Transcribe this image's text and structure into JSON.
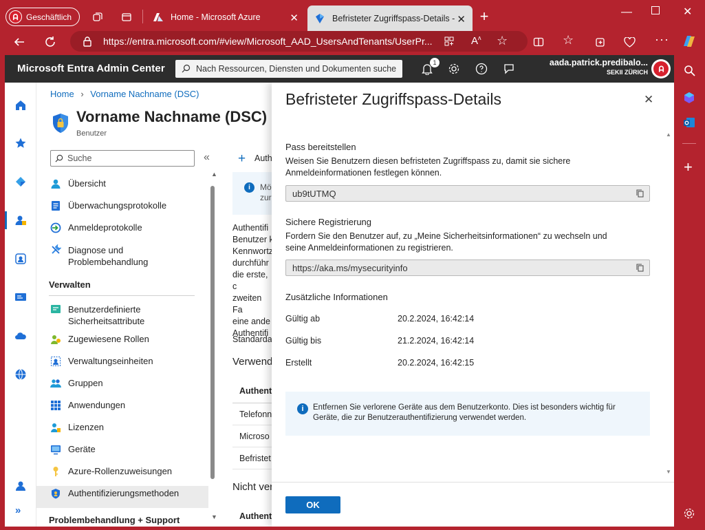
{
  "browser": {
    "profile_label": "Geschäftlich",
    "tabs": [
      {
        "title": "Home - Microsoft Azure"
      },
      {
        "title": "Befristeter Zugriffspass-Details -"
      }
    ],
    "url": "https://entra.microsoft.com/#view/Microsoft_AAD_UsersAndTenants/UserPr..."
  },
  "header": {
    "brand": "Microsoft Entra Admin Center",
    "search_placeholder": "Nach Ressourcen, Diensten und Dokumenten suche",
    "notification_count": "1",
    "user_name": "aada.patrick.predibalo...",
    "tenant": "SEKII ZÜRICH"
  },
  "breadcrumb": {
    "home": "Home",
    "current": "Vorname Nachname (DSC)"
  },
  "page": {
    "title": "Vorname Nachname (DSC)",
    "subtitle": "Benutzer"
  },
  "left": {
    "search_placeholder": "Suche",
    "collapse": "«",
    "items_top": [
      {
        "label": "Übersicht",
        "icon": "user-icon"
      },
      {
        "label": "Überwachungsprotokolle",
        "icon": "log-icon"
      },
      {
        "label": "Anmeldeprotokolle",
        "icon": "signin-icon"
      },
      {
        "label": "Diagnose und Problembehandlung",
        "icon": "wrench-icon"
      }
    ],
    "section_manage": "Verwalten",
    "items_manage": [
      {
        "label": "Benutzerdefinierte Sicherheitsattribute",
        "icon": "attribute-icon"
      },
      {
        "label": "Zugewiesene Rollen",
        "icon": "roles-icon"
      },
      {
        "label": "Verwaltungseinheiten",
        "icon": "admin-units-icon"
      },
      {
        "label": "Gruppen",
        "icon": "groups-icon"
      },
      {
        "label": "Anwendungen",
        "icon": "apps-icon"
      },
      {
        "label": "Lizenzen",
        "icon": "license-icon"
      },
      {
        "label": "Geräte",
        "icon": "device-icon"
      },
      {
        "label": "Azure-Rollenzuweisungen",
        "icon": "key-icon"
      },
      {
        "label": "Authentifizierungsmethoden",
        "icon": "shield-icon"
      }
    ],
    "section_support": "Problembehandlung + Support"
  },
  "middle": {
    "add_label": "Auth",
    "info": [
      "Mö",
      "zur"
    ],
    "paragraph": [
      "Authentifi",
      "Benutzer k",
      "Kennwortz",
      "durchführ",
      "die erste, c",
      "zweiten Fa",
      "eine ande",
      "Authentifi"
    ],
    "default_label": "Standarda",
    "used_heading": "Verwend",
    "table_header": "Authent",
    "rows": [
      "Telefonn",
      "Microso",
      "Befristet"
    ],
    "not_used_heading": "Nicht ver",
    "table_header2": "Authent"
  },
  "panel": {
    "title": "Befristeter Zugriffspass-Details",
    "pass_heading": "Pass bereitstellen",
    "pass_desc": "Weisen Sie Benutzern diesen befristeten Zugriffspass zu, damit sie sichere Anmeldeinformationen festlegen können.",
    "pass_value": "ub9tUTMQ",
    "reg_heading": "Sichere Registrierung",
    "reg_desc": "Fordern Sie den Benutzer auf, zu „Meine Sicherheitsinformationen“ zu wechseln und seine Anmeldeinformationen zu registrieren.",
    "reg_value": "https://aka.ms/mysecurityinfo",
    "extra_heading": "Zusätzliche Informationen",
    "details": [
      {
        "label": "Gültig ab",
        "value": "20.2.2024, 16:42:14"
      },
      {
        "label": "Gültig bis",
        "value": "21.2.2024, 16:42:14"
      },
      {
        "label": "Erstellt",
        "value": "20.2.2024, 16:42:15"
      }
    ],
    "info_text": "Entfernen Sie verlorene Geräte aus dem Benutzerkonto. Dies ist besonders wichtig für Geräte, die zur Benutzerauthentifizierung verwendet werden.",
    "ok_label": "OK"
  }
}
